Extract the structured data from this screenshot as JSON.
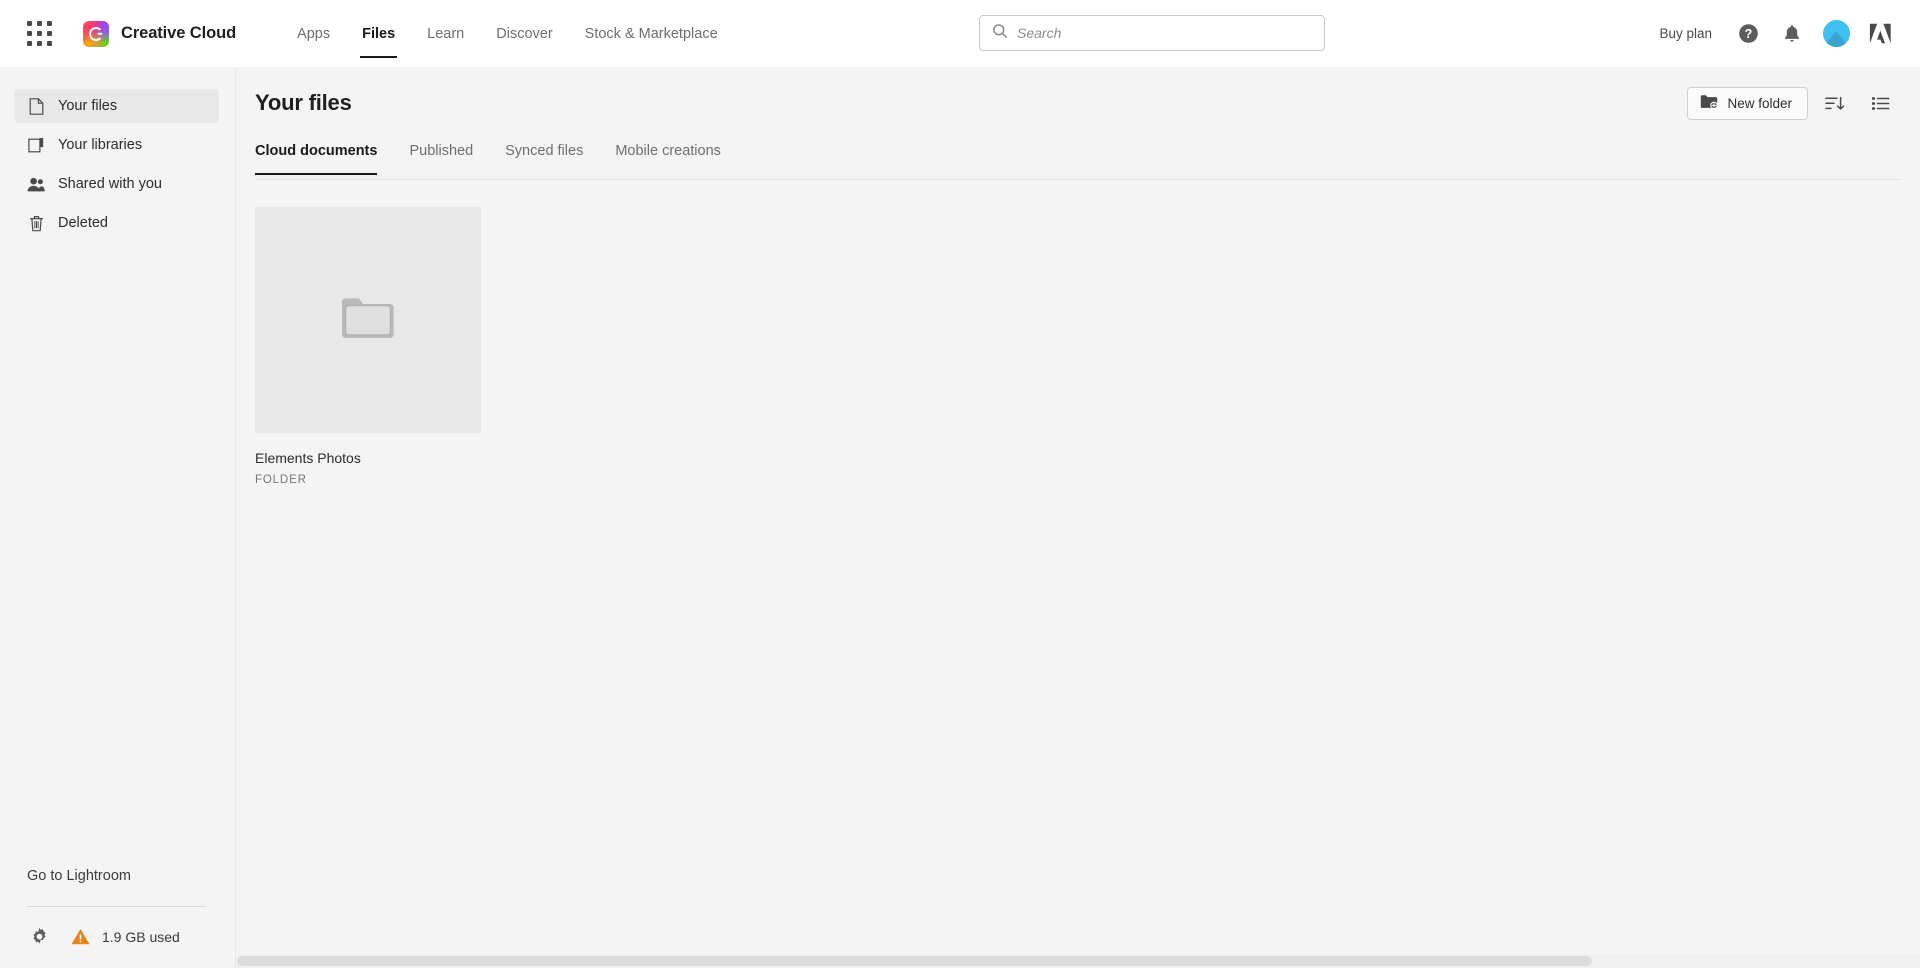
{
  "header": {
    "app_grid_icon": "app-grid-icon",
    "brand_name": "Creative Cloud",
    "brand_logo_icon": "creative-cloud-logo-icon",
    "nav": [
      {
        "label": "Apps",
        "active": false
      },
      {
        "label": "Files",
        "active": true
      },
      {
        "label": "Learn",
        "active": false
      },
      {
        "label": "Discover",
        "active": false
      },
      {
        "label": "Stock & Marketplace",
        "active": false
      }
    ],
    "search": {
      "placeholder": "Search",
      "value": "",
      "icon": "search-icon"
    },
    "buy_plan_label": "Buy plan",
    "help_icon": "help-circle-icon",
    "notifications_icon": "bell-icon",
    "avatar_icon": "user-avatar",
    "adobe_logo_icon": "adobe-logo-icon"
  },
  "sidebar": {
    "items": [
      {
        "label": "Your files",
        "icon": "document-icon",
        "selected": true
      },
      {
        "label": "Your libraries",
        "icon": "library-icon",
        "selected": false
      },
      {
        "label": "Shared with you",
        "icon": "people-icon",
        "selected": false
      },
      {
        "label": "Deleted",
        "icon": "trash-icon",
        "selected": false
      }
    ],
    "lightroom_link": "Go to Lightroom",
    "settings_icon": "gear-icon",
    "storage_warning_icon": "warning-triangle-icon",
    "storage_text": "1.9 GB used"
  },
  "main": {
    "page_title": "Your files",
    "new_folder_label": "New folder",
    "new_folder_icon": "new-folder-icon",
    "sort_icon": "sort-icon",
    "view_list_icon": "list-view-icon",
    "tabs": [
      {
        "label": "Cloud documents",
        "active": true
      },
      {
        "label": "Published",
        "active": false
      },
      {
        "label": "Synced files",
        "active": false
      },
      {
        "label": "Mobile creations",
        "active": false
      }
    ],
    "files": [
      {
        "name": "Elements Photos",
        "type": "FOLDER",
        "icon": "folder-icon"
      }
    ]
  },
  "colors": {
    "page_bg": "#f4f4f4",
    "header_bg": "#ffffff",
    "accent_active": "#1a1a1a",
    "warning": "#e8851a",
    "avatar": "#3ec0f0",
    "thumb_bg": "#e8e8e8"
  }
}
